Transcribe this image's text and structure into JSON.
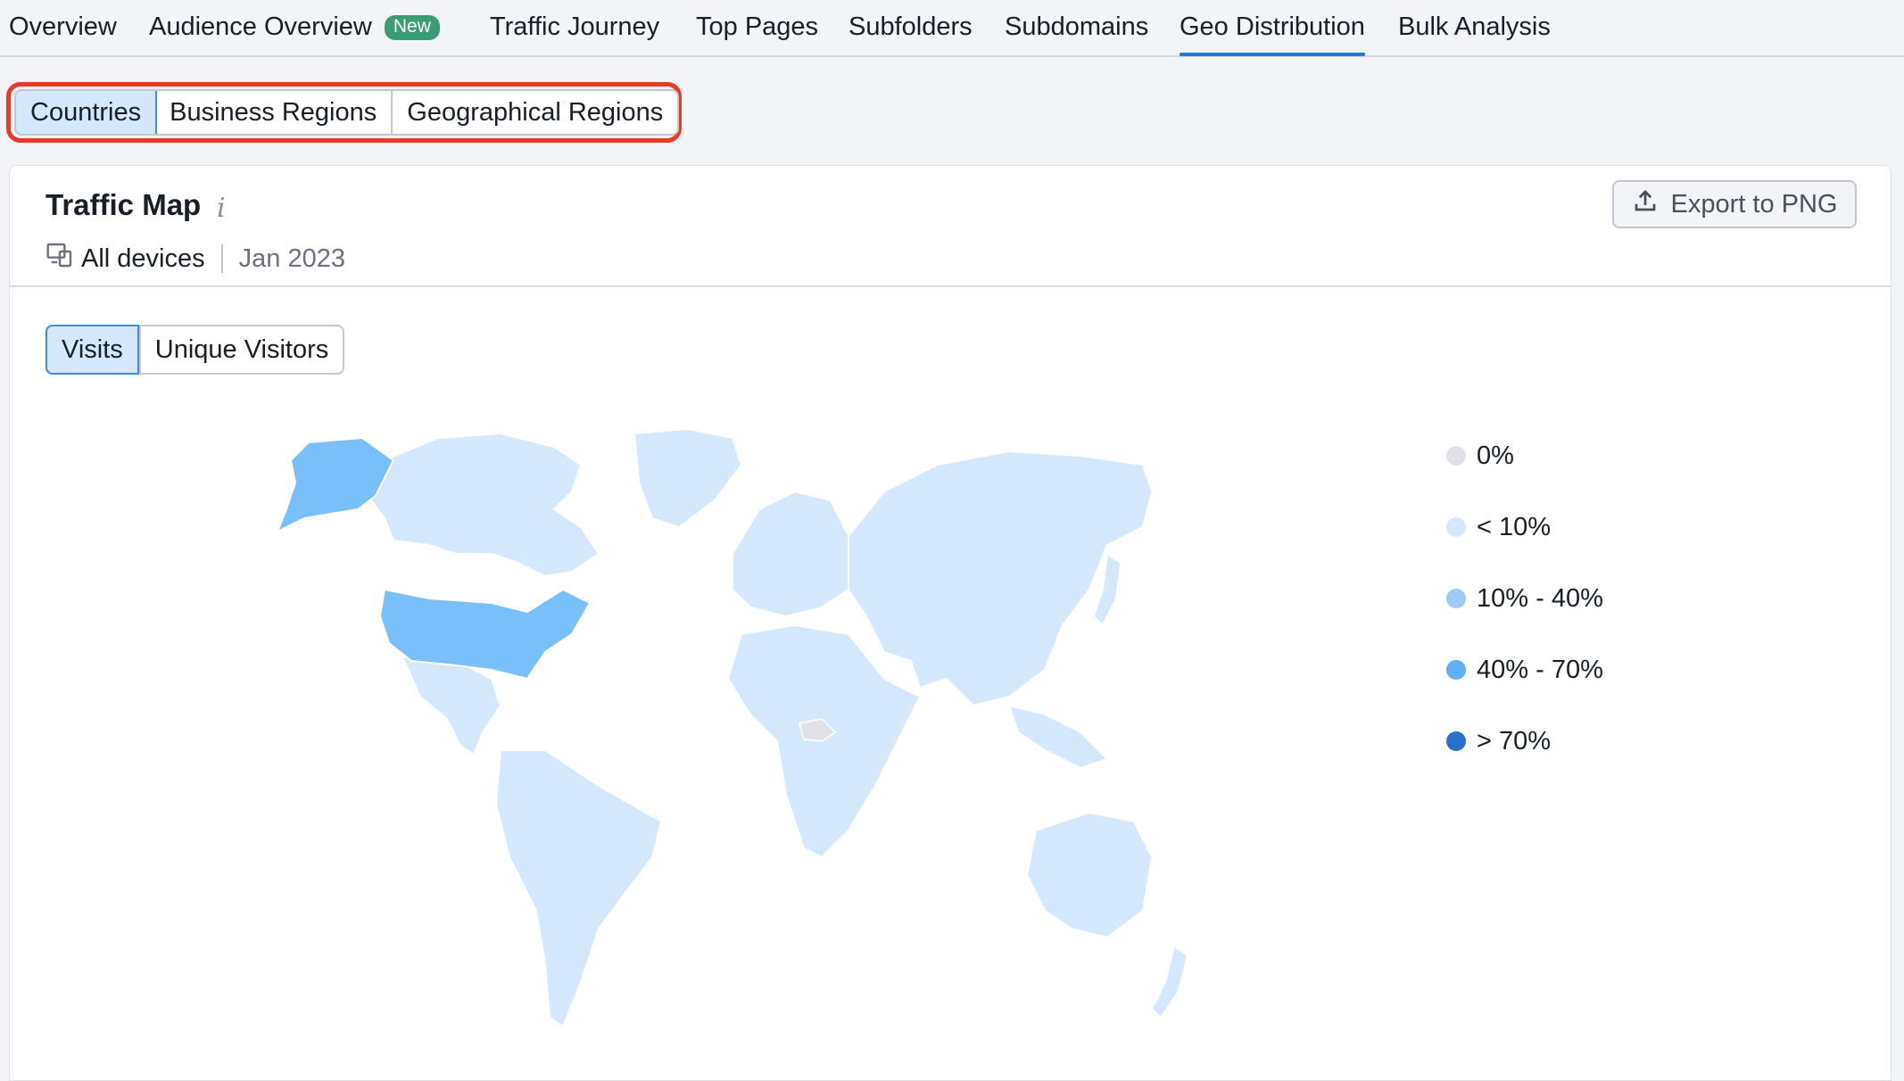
{
  "nav": {
    "items": [
      {
        "label": "Overview"
      },
      {
        "label": "Audience Overview",
        "badge": "New"
      },
      {
        "label": "Traffic Journey"
      },
      {
        "label": "Top Pages"
      },
      {
        "label": "Subfolders"
      },
      {
        "label": "Subdomains"
      },
      {
        "label": "Geo Distribution",
        "active": true
      },
      {
        "label": "Bulk Analysis"
      }
    ]
  },
  "subtabs": [
    "Countries",
    "Business Regions",
    "Geographical Regions"
  ],
  "card": {
    "title": "Traffic Map",
    "info_icon": "info-icon",
    "export_label": "Export to PNG",
    "devices_label": "All devices",
    "date": "Jan 2023",
    "metrics": [
      "Visits",
      "Unique Visitors"
    ]
  },
  "legend": [
    {
      "label": "0%",
      "color": "#dfe1e6"
    },
    {
      "label": "< 10%",
      "color": "#d4e7fb"
    },
    {
      "label": "10% - 40%",
      "color": "#9ecbf6"
    },
    {
      "label": "40% - 70%",
      "color": "#5eb1f5"
    },
    {
      "label": "> 70%",
      "color": "#2a6fcc"
    }
  ],
  "map_colors": {
    "base": "#d4e7fb",
    "usa": "#79c0fa",
    "alaska": "#79c0fa",
    "zero": "#dfe1e6"
  }
}
